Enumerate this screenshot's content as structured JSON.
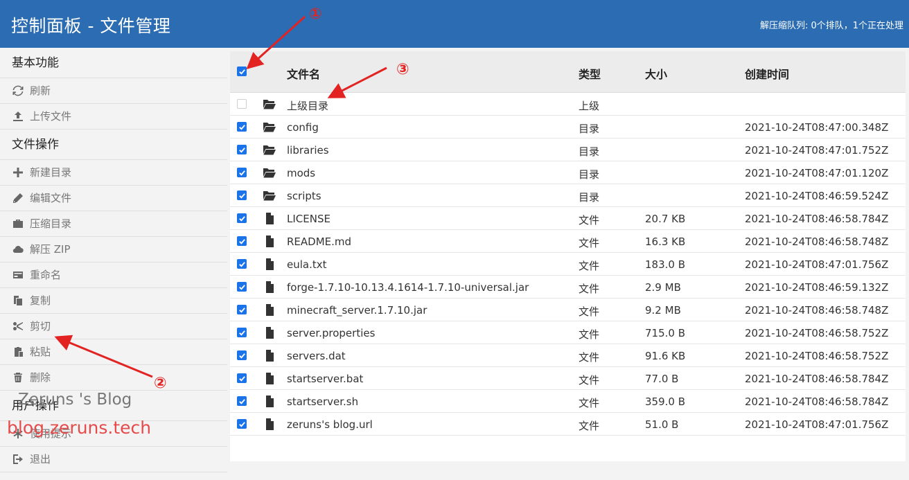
{
  "header": {
    "title": "控制面板 - 文件管理",
    "queue_status": "解压缩队列: 0个排队，1个正在处理"
  },
  "sidebar": {
    "sections": [
      {
        "title": "基本功能",
        "items": [
          {
            "label": "刷新",
            "icon": "refresh-icon"
          },
          {
            "label": "上传文件",
            "icon": "upload-icon"
          }
        ]
      },
      {
        "title": "文件操作",
        "items": [
          {
            "label": "新建目录",
            "icon": "plus-icon"
          },
          {
            "label": "编辑文件",
            "icon": "pencil-icon"
          },
          {
            "label": "压缩目录",
            "icon": "briefcase-icon"
          },
          {
            "label": "解压 ZIP",
            "icon": "cloud-icon"
          },
          {
            "label": "重命名",
            "icon": "card-icon"
          },
          {
            "label": "复制",
            "icon": "copy-icon"
          },
          {
            "label": "剪切",
            "icon": "scissors-icon"
          },
          {
            "label": "粘贴",
            "icon": "paste-icon"
          },
          {
            "label": "删除",
            "icon": "trash-icon"
          }
        ]
      },
      {
        "title": "用户操作",
        "items": [
          {
            "label": "使用提示",
            "icon": "asterisk-icon"
          },
          {
            "label": "退出",
            "icon": "logout-icon"
          }
        ]
      }
    ]
  },
  "table": {
    "columns": {
      "name": "文件名",
      "type": "类型",
      "size": "大小",
      "time": "创建时间"
    },
    "rows": [
      {
        "checked": false,
        "kind": "folder",
        "name": "上级目录",
        "type": "上级",
        "size": "",
        "time": ""
      },
      {
        "checked": true,
        "kind": "folder",
        "name": "config",
        "type": "目录",
        "size": "",
        "time": "2021-10-24T08:47:00.348Z"
      },
      {
        "checked": true,
        "kind": "folder",
        "name": "libraries",
        "type": "目录",
        "size": "",
        "time": "2021-10-24T08:47:01.752Z"
      },
      {
        "checked": true,
        "kind": "folder",
        "name": "mods",
        "type": "目录",
        "size": "",
        "time": "2021-10-24T08:47:01.120Z"
      },
      {
        "checked": true,
        "kind": "folder",
        "name": "scripts",
        "type": "目录",
        "size": "",
        "time": "2021-10-24T08:46:59.524Z"
      },
      {
        "checked": true,
        "kind": "file",
        "name": "LICENSE",
        "type": "文件",
        "size": "20.7 KB",
        "time": "2021-10-24T08:46:58.784Z"
      },
      {
        "checked": true,
        "kind": "file",
        "name": "README.md",
        "type": "文件",
        "size": "16.3 KB",
        "time": "2021-10-24T08:46:58.748Z"
      },
      {
        "checked": true,
        "kind": "file",
        "name": "eula.txt",
        "type": "文件",
        "size": "183.0 B",
        "time": "2021-10-24T08:47:01.756Z"
      },
      {
        "checked": true,
        "kind": "file",
        "name": "forge-1.7.10-10.13.4.1614-1.7.10-universal.jar",
        "type": "文件",
        "size": "2.9 MB",
        "time": "2021-10-24T08:46:59.132Z"
      },
      {
        "checked": true,
        "kind": "file",
        "name": "minecraft_server.1.7.10.jar",
        "type": "文件",
        "size": "9.2 MB",
        "time": "2021-10-24T08:46:58.748Z"
      },
      {
        "checked": true,
        "kind": "file",
        "name": "server.properties",
        "type": "文件",
        "size": "715.0 B",
        "time": "2021-10-24T08:46:58.752Z"
      },
      {
        "checked": true,
        "kind": "file",
        "name": "servers.dat",
        "type": "文件",
        "size": "91.6 KB",
        "time": "2021-10-24T08:46:58.752Z"
      },
      {
        "checked": true,
        "kind": "file",
        "name": "startserver.bat",
        "type": "文件",
        "size": "77.0 B",
        "time": "2021-10-24T08:46:58.784Z"
      },
      {
        "checked": true,
        "kind": "file",
        "name": "startserver.sh",
        "type": "文件",
        "size": "359.0 B",
        "time": "2021-10-24T08:46:58.784Z"
      },
      {
        "checked": true,
        "kind": "file",
        "name": "zeruns's blog.url",
        "type": "文件",
        "size": "51.0 B",
        "time": "2021-10-24T08:47:01.756Z"
      }
    ]
  },
  "watermark": {
    "line1": "Zeruns 's Blog",
    "line2": "blog.zeruns.tech"
  },
  "annotations": {
    "a1": "①",
    "a2": "②",
    "a3": "③"
  },
  "colors": {
    "header_bg": "#2b6cb2",
    "checkbox": "#1a73e8",
    "annotation": "#e32222"
  }
}
